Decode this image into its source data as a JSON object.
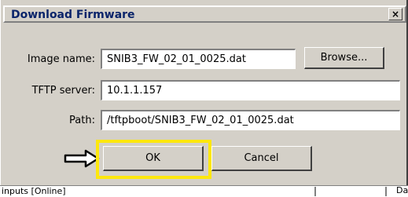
{
  "dialog": {
    "title": "Download Firmware",
    "close_glyph": "×"
  },
  "form": {
    "image_name": {
      "label": "Image name:",
      "value": "SNIB3_FW_02_01_0025.dat"
    },
    "browse_label": "Browse...",
    "tftp_server": {
      "label": "TFTP server:",
      "value": "10.1.1.157"
    },
    "path": {
      "label": "Path:",
      "value": "/tftpboot/SNIB3_FW_02_01_0025.dat"
    }
  },
  "buttons": {
    "ok_label": "OK",
    "cancel_label": "Cancel"
  },
  "annotation": {
    "highlight_color": "#fde70d",
    "arrow_icon": "arrow-right-icon"
  },
  "statusbar": {
    "left_text": "inputs [Online]",
    "right_text": "Da"
  },
  "colors": {
    "dialog_bg": "#d4d0c8",
    "title_text": "#0a246a"
  }
}
